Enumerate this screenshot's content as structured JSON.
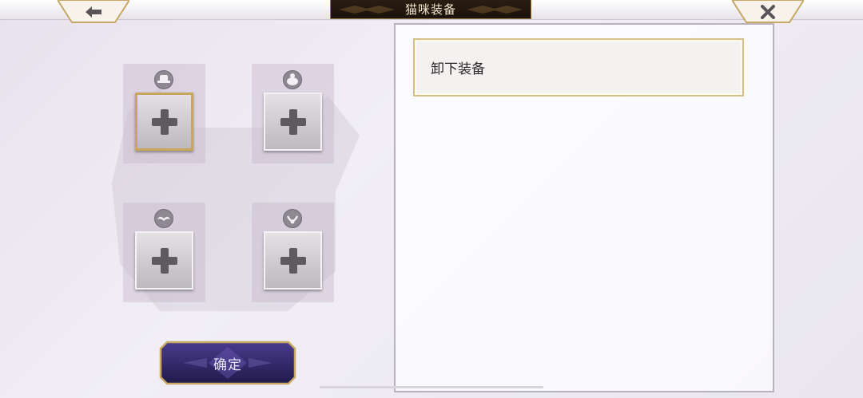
{
  "header": {
    "title": "猫咪装备",
    "back_icon": "back-arrow-icon",
    "close_icon": "close-icon"
  },
  "slots": [
    {
      "icon": "hat-icon",
      "selected": true
    },
    {
      "icon": "face-icon",
      "selected": false
    },
    {
      "icon": "mustache-icon",
      "selected": false
    },
    {
      "icon": "necklace-icon",
      "selected": false
    }
  ],
  "confirm_label": "确定",
  "list": {
    "items": [
      {
        "label": "卸下装备"
      }
    ]
  },
  "colors": {
    "accent_gold": "#c9a55d",
    "title_bg": "#1b120b",
    "confirm_bg": "#2e2460"
  }
}
